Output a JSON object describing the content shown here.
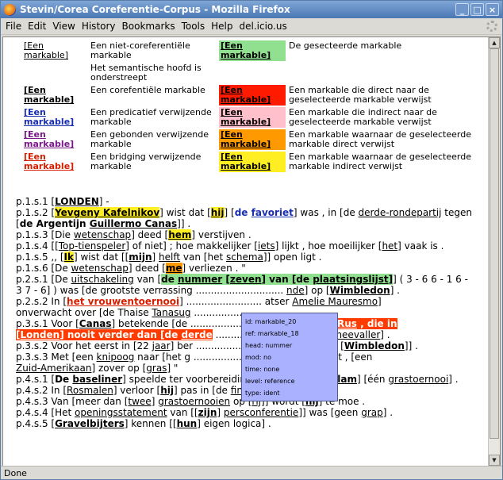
{
  "window": {
    "title": "Stevin/Corea Coreferentie-Corpus - Mozilla Firefox"
  },
  "menu": [
    "File",
    "Edit",
    "View",
    "History",
    "Bookmarks",
    "Tools",
    "Help",
    "del.icio.us"
  ],
  "legend": {
    "rows": [
      {
        "c1": "[Een markable]",
        "c2": "Een niet-coreferentiële markable",
        "c3": "[Een markable]",
        "c4": "De gesecteerde markable"
      },
      {
        "c1": "",
        "c2": "Het semantische hoofd is onderstreept",
        "c3": "",
        "c4": ""
      },
      {
        "c1": "[Een markable]",
        "c2": "Een corefentiële markable",
        "c3": "[Een markable]",
        "c4": "Een markable die direct naar de geselecteerde markable verwijst"
      },
      {
        "c1": "[Een markable]",
        "c2": "Een predicatief verwijzende markable",
        "c3": "[Een markable]",
        "c4": "Een markable die indirect naar de geselecteerde markable verwijst"
      },
      {
        "c1": "[Een markable]",
        "c2": "Een gebonden verwijzende markable",
        "c3": "[Een markable]",
        "c4": "Een markable waarnaar de geselecteerde markable direct verwijst"
      },
      {
        "c1": "[Een markable]",
        "c2": "Een bridging verwijzende markable",
        "c3": "[Een markable]",
        "c4": "Een markable waarnaar de geselecteerde markable indirect verwijst"
      }
    ],
    "colors": {
      "green": "#90e090",
      "red": "#ff1a00",
      "pink": "#ffc0cb",
      "orange": "#ff9900",
      "yellow": "#ffee22",
      "c1_black": "#000000",
      "c1_blue": "#1a2fb0",
      "c1_purple": "#7a1a8a",
      "c1_red": "#d42000"
    }
  },
  "tooltip": {
    "lines": [
      "id: markable_20",
      "ref: markable_18",
      "head: nummer",
      "mod: no",
      "time: none",
      "level: reference",
      "type: ident"
    ]
  },
  "status": "Done"
}
